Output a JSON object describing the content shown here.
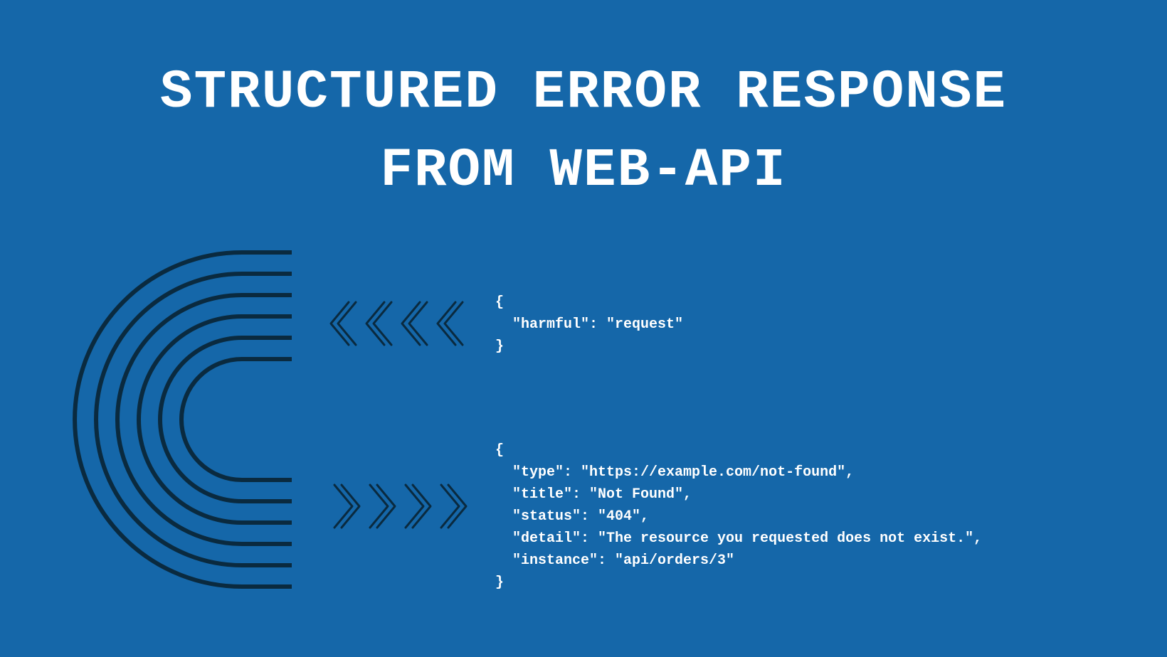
{
  "title": {
    "line1": "STRUCTURED ERROR RESPONSE",
    "line2": "FROM WEB-API"
  },
  "colors": {
    "background": "#1567a9",
    "text": "#ffffff",
    "lineart": "#0a2a3f"
  },
  "request_block": "{\n  \"harmful\": \"request\"\n}",
  "response_block": "{\n  \"type\": \"https://example.com/not-found\",\n  \"title\": \"Not Found\",\n  \"status\": \"404\",\n  \"detail\": \"The resource you requested does not exist.\",\n  \"instance\": \"api/orders/3\"\n}"
}
